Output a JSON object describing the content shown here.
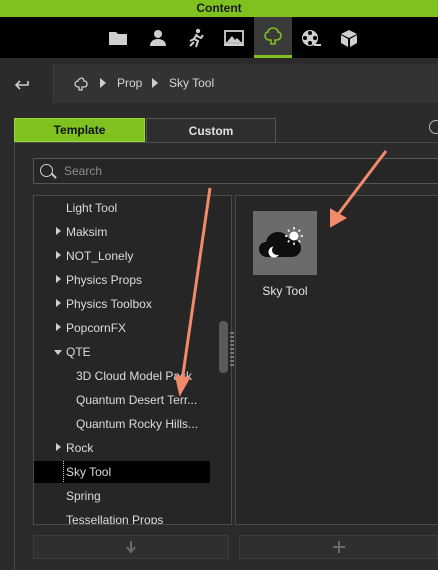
{
  "titlebar": {
    "title": "Content"
  },
  "tabs": [
    {
      "icon": "folder-icon"
    },
    {
      "icon": "person-icon"
    },
    {
      "icon": "motion-icon"
    },
    {
      "icon": "stage-icon"
    },
    {
      "icon": "prop-tree-icon",
      "active": true
    },
    {
      "icon": "film-reel-icon"
    },
    {
      "icon": "box-icon"
    }
  ],
  "breadcrumb": {
    "items": [
      "Prop",
      "Sky Tool"
    ]
  },
  "panel_tabs": {
    "template": "Template",
    "custom": "Custom"
  },
  "search": {
    "placeholder": "Search",
    "value": ""
  },
  "tree": {
    "items": [
      {
        "label": "Light Tool",
        "expander": "none",
        "level": 0
      },
      {
        "label": "Maksim",
        "expander": "collapsed",
        "level": 0
      },
      {
        "label": "NOT_Lonely",
        "expander": "collapsed",
        "level": 0
      },
      {
        "label": "Physics Props",
        "expander": "collapsed",
        "level": 0
      },
      {
        "label": "Physics Toolbox",
        "expander": "collapsed",
        "level": 0
      },
      {
        "label": "PopcornFX",
        "expander": "collapsed",
        "level": 0
      },
      {
        "label": "QTE",
        "expander": "expanded",
        "level": 0
      },
      {
        "label": "3D Cloud Model Pack",
        "expander": "none",
        "level": 1
      },
      {
        "label": "Quantum Desert Terr...",
        "expander": "none",
        "level": 1
      },
      {
        "label": "Quantum Rocky Hills...",
        "expander": "none",
        "level": 1
      },
      {
        "label": "Rock",
        "expander": "collapsed",
        "level": 0
      },
      {
        "label": "Sky Tool",
        "expander": "none",
        "level": 0,
        "selected": true
      },
      {
        "label": "Spring",
        "expander": "none",
        "level": 0
      },
      {
        "label": "Tessellation Props",
        "expander": "none",
        "level": 0
      }
    ]
  },
  "content_items": [
    {
      "label": "Sky Tool",
      "icon": "cloud-sun-moon-icon"
    }
  ],
  "bottom_buttons": {
    "down_icon": "arrow-down-icon",
    "add_icon": "plus-icon"
  },
  "colors": {
    "accent": "#7fc21f",
    "annotation_arrow": "#f08a6a",
    "panel_bg": "#262626"
  }
}
